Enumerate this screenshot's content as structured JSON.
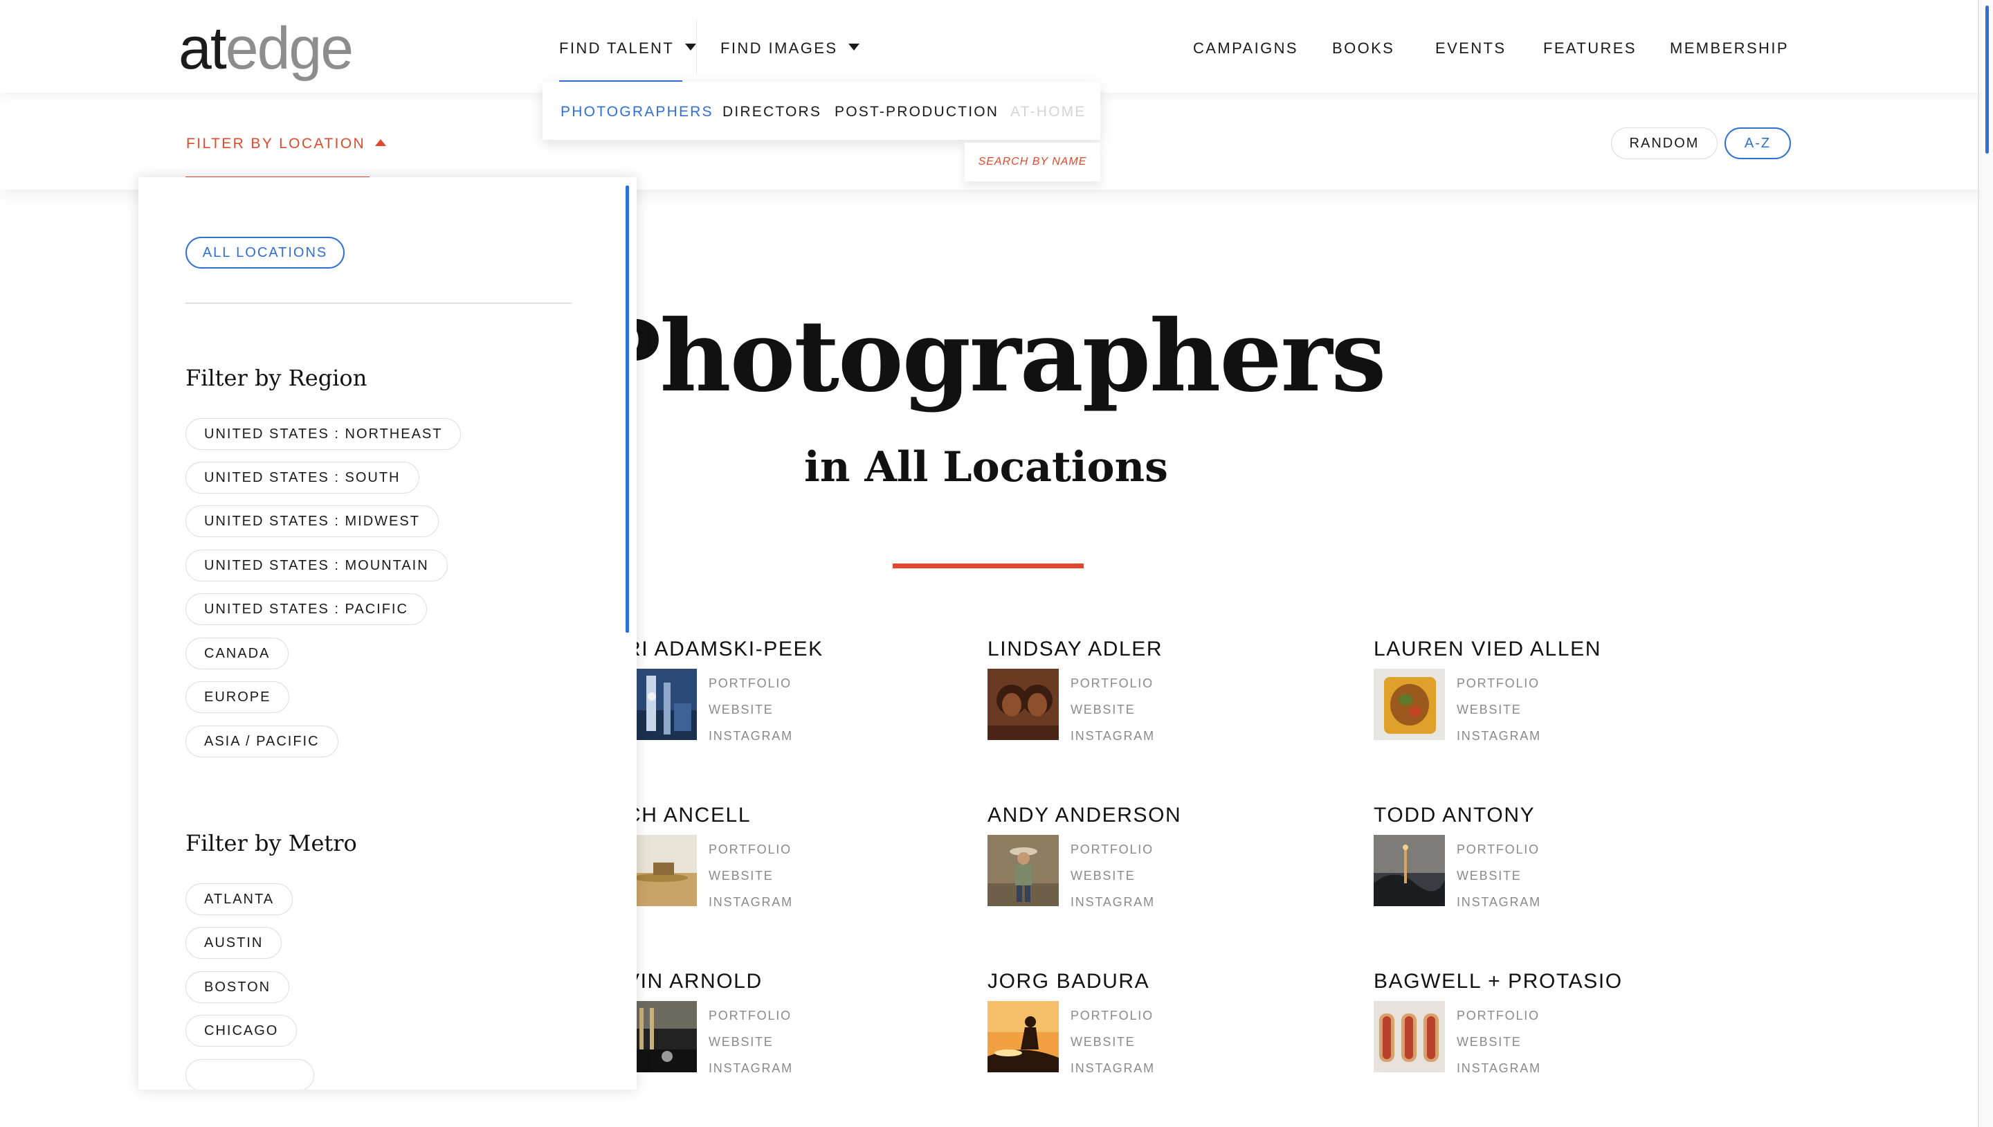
{
  "logo": {
    "part1": "at",
    "part2": "edge"
  },
  "nav": {
    "find_talent": "FIND TALENT",
    "find_images": "FIND IMAGES",
    "right": [
      "CAMPAIGNS",
      "BOOKS",
      "EVENTS",
      "FEATURES",
      "MEMBERSHIP"
    ]
  },
  "talent_menu": {
    "items": [
      "PHOTOGRAPHERS",
      "DIRECTORS",
      "POST-PRODUCTION",
      "AT-HOME"
    ],
    "active": "PHOTOGRAPHERS",
    "search_by_name": "SEARCH BY NAME"
  },
  "filter_bar": {
    "filter_label": "FILTER BY LOCATION",
    "sort": {
      "random": "RANDOM",
      "az": "A-Z",
      "selected": "A-Z"
    }
  },
  "filter_panel": {
    "all_locations": "ALL LOCATIONS",
    "region_heading": "Filter by Region",
    "regions": [
      "UNITED STATES : NORTHEAST",
      "UNITED STATES : SOUTH",
      "UNITED STATES : MIDWEST",
      "UNITED STATES : MOUNTAIN",
      "UNITED STATES : PACIFIC",
      "CANADA",
      "EUROPE",
      "ASIA / PACIFIC"
    ],
    "metro_heading": "Filter by Metro",
    "metros": [
      "ATLANTA",
      "AUSTIN",
      "BOSTON",
      "CHICAGO"
    ]
  },
  "hero": {
    "title": "Photographers",
    "subtitle": "in All Locations"
  },
  "link_labels": {
    "portfolio": "PORTFOLIO",
    "website": "WEBSITE",
    "instagram": "INSTAGRAM"
  },
  "photographers": [
    {
      "name": "RI ADAMSKI-PEEK",
      "thumb": "city-night"
    },
    {
      "name": "LINDSAY ADLER",
      "thumb": "portrait-women"
    },
    {
      "name": "LAUREN VIED ALLEN",
      "thumb": "food-dish"
    },
    {
      "name": "CH ANCELL",
      "thumb": "desert"
    },
    {
      "name": "ANDY ANDERSON",
      "thumb": "cowboy"
    },
    {
      "name": "TODD ANTONY",
      "thumb": "night-landscape"
    },
    {
      "name": "VIN ARNOLD",
      "thumb": "bw-street"
    },
    {
      "name": "JORG BADURA",
      "thumb": "sunset-silhouette"
    },
    {
      "name": "BAGWELL + PROTASIO",
      "thumb": "hotdogs"
    }
  ],
  "colors": {
    "accent_red": "#e0492d",
    "accent_blue": "#2f6fd6"
  }
}
